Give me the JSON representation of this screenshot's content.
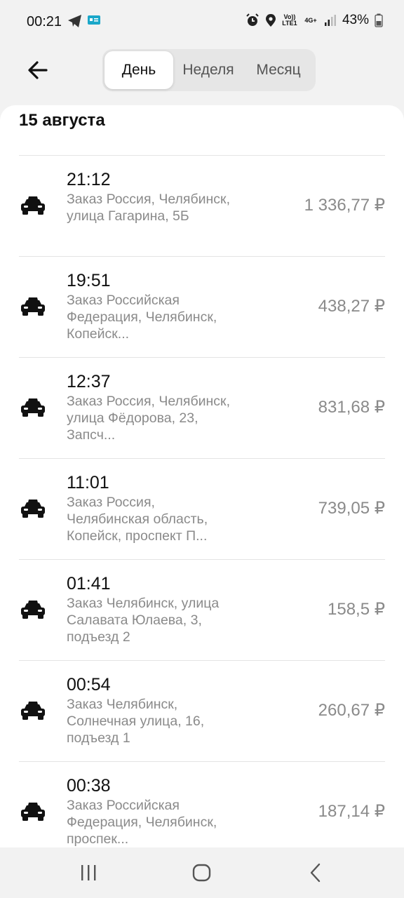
{
  "status_bar": {
    "time": "00:21",
    "battery": "43%",
    "volte": "Vo)) LTE1",
    "net": "4G+",
    "icons": [
      "telegram-icon",
      "message-icon",
      "alarm-icon",
      "location-icon",
      "signal-icon",
      "battery-icon"
    ]
  },
  "header": {
    "back_icon": "arrow-left-icon",
    "tabs": [
      {
        "label": "День",
        "active": true
      },
      {
        "label": "Неделя",
        "active": false
      },
      {
        "label": "Месяц",
        "active": false
      }
    ]
  },
  "date_header": "15 августа",
  "orders": [
    {
      "time": "21:12",
      "address": "Заказ Россия, Челябинск, улица Гагарина, 5Б",
      "price": "1 336,77 ₽",
      "icon": "taxi-icon"
    },
    {
      "time": "19:51",
      "address": "Заказ Российская Федерация, Челябинск, Копейск...",
      "price": "438,27 ₽",
      "icon": "taxi-icon"
    },
    {
      "time": "12:37",
      "address": "Заказ Россия, Челябинск, улица Фёдорова, 23, Запсч...",
      "price": "831,68 ₽",
      "icon": "taxi-icon"
    },
    {
      "time": "11:01",
      "address": "Заказ Россия, Челябинская область, Копейск, проспект П...",
      "price": "739,05 ₽",
      "icon": "taxi-icon"
    },
    {
      "time": "01:41",
      "address": "Заказ Челябинск, улица Салавата Юлаева, 3, подъезд 2",
      "price": "158,5 ₽",
      "icon": "taxi-icon"
    },
    {
      "time": "00:54",
      "address": "Заказ Челябинск, Солнечная улица, 16, подъезд 1",
      "price": "260,67 ₽",
      "icon": "taxi-icon"
    },
    {
      "time": "00:38",
      "address": "Заказ Российская Федерация, Челябинск, проспек...",
      "price": "187,14 ₽",
      "icon": "taxi-icon"
    }
  ],
  "nav_bar": {
    "icons": [
      "recent-apps-icon",
      "home-icon",
      "back-icon"
    ]
  }
}
